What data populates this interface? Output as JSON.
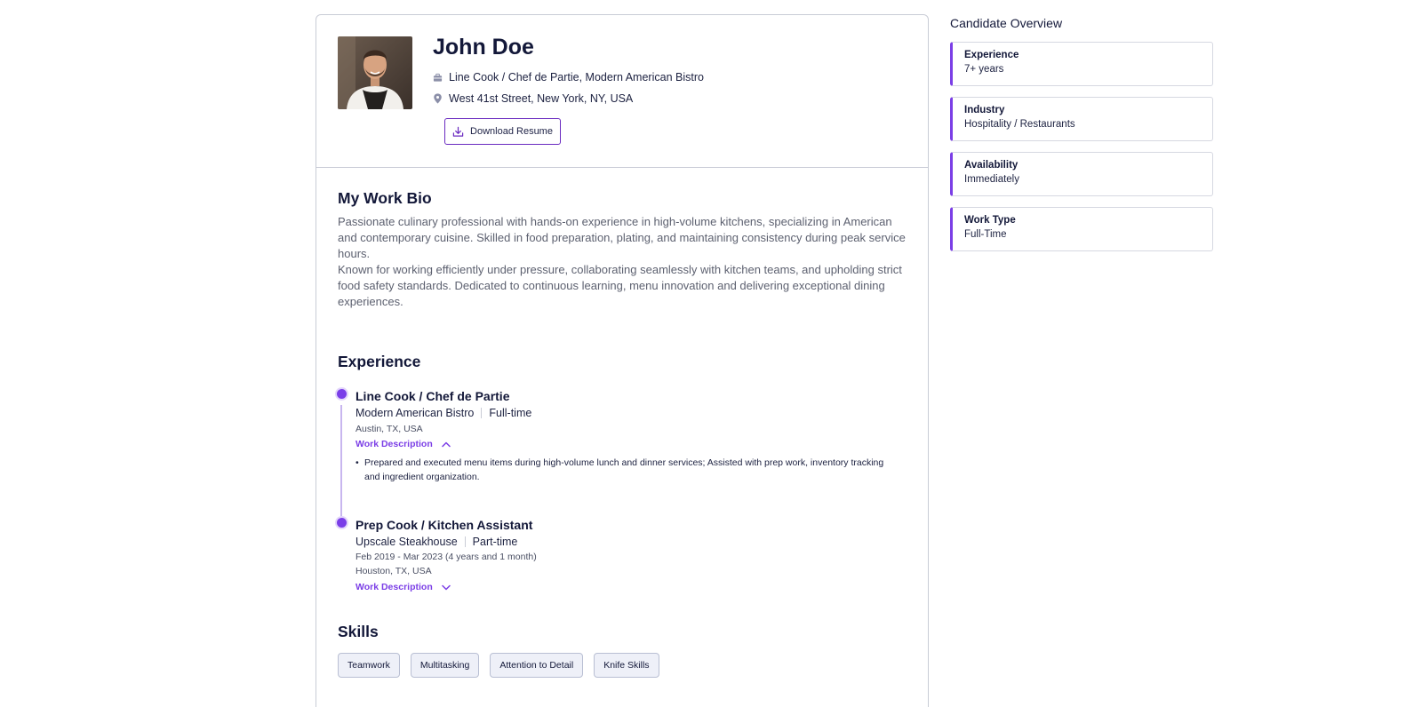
{
  "profile": {
    "name": "John Doe",
    "job": "Line Cook / Chef de Partie, Modern American Bistro",
    "location": "West 41st Street, New York, NY, USA",
    "download_label": "Download Resume"
  },
  "bio": {
    "title": "My Work Bio",
    "paragraph1": "Passionate culinary professional with hands-on experience in high-volume kitchens, specializing in American and contemporary cuisine. Skilled in food preparation, plating, and maintaining consistency during peak service hours.",
    "paragraph2": "Known for working efficiently under pressure, collaborating seamlessly with kitchen teams, and upholding strict food safety standards. Dedicated to continuous learning, menu innovation and delivering exceptional dining experiences."
  },
  "experience": {
    "title": "Experience",
    "items": [
      {
        "title": "Line Cook / Chef de Partie",
        "company": "Modern American Bistro",
        "type": "Full-time",
        "location": "Austin, TX, USA",
        "toggle_label": "Work Description",
        "expanded": true,
        "description": "Prepared and executed menu items during high-volume lunch and dinner services; Assisted with prep work, inventory tracking and ingredient organization."
      },
      {
        "title": "Prep Cook / Kitchen Assistant",
        "company": "Upscale Steakhouse",
        "type": "Part-time",
        "dates": "Feb 2019 - Mar 2023 (4 years and 1 month)",
        "location": "Houston, TX, USA",
        "toggle_label": "Work Description",
        "expanded": false
      }
    ]
  },
  "skills": {
    "title": "Skills",
    "items": [
      "Teamwork",
      "Multitasking",
      "Attention to Detail",
      "Knife Skills"
    ]
  },
  "overview": {
    "title": "Candidate Overview",
    "cards": [
      {
        "label": "Experience",
        "value": "7+ years"
      },
      {
        "label": "Industry",
        "value": "Hospitality / Restaurants"
      },
      {
        "label": "Availability",
        "value": "Immediately"
      },
      {
        "label": "Work Type",
        "value": "Full-Time"
      }
    ]
  },
  "colors": {
    "accent": "#7b3ee6",
    "accent_light": "#c8b6ef",
    "heading": "#131839",
    "body_text": "#5d6170",
    "border": "#c9ccd6",
    "chip_bg": "#eef0f8"
  },
  "icons": [
    "briefcase-icon",
    "location-pin-icon",
    "download-icon",
    "chevron-up-icon",
    "chevron-down-icon"
  ]
}
